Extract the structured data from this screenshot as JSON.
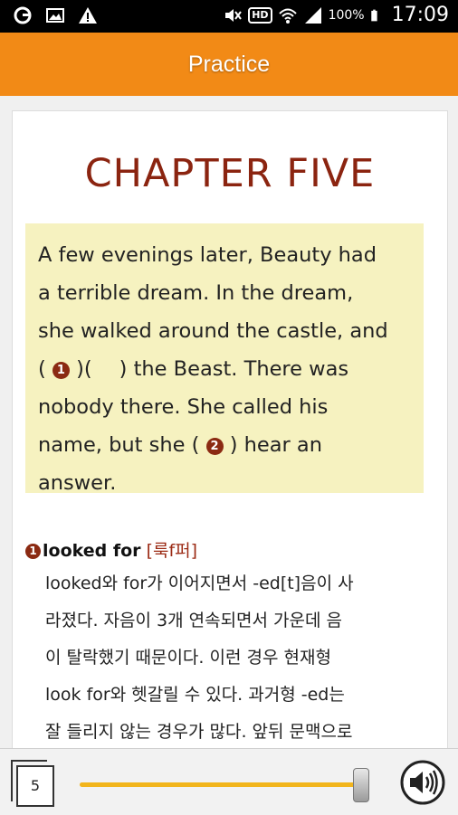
{
  "status_bar": {
    "battery_percent": "100%",
    "time": "17:09",
    "hd_label": "HD",
    "icons": [
      "g-app-icon",
      "image-icon",
      "warning-icon",
      "mute-icon",
      "hd-icon",
      "wifi-icon",
      "signal-icon",
      "battery-icon"
    ]
  },
  "header": {
    "title": "Practice"
  },
  "content": {
    "chapter_title": "CHAPTER FIVE",
    "passage": {
      "line1": "A few evenings later, Beauty had",
      "line2": "a terrible dream. In the dream,",
      "line3": "she walked around the castle, and",
      "line4_a": "( ",
      "line4_b": " )(",
      "line4_c": ") the Beast. There was",
      "line5": "nobody there. She called his",
      "line6_a": "name, but she ( ",
      "line6_b": " ) hear an",
      "line7": "answer.",
      "blank1_number": "1",
      "blank2_number": "2"
    },
    "note": {
      "number": "1",
      "term": "looked for",
      "pronunciation": "[룩f퍼]",
      "lines": [
        "looked와 for가 이어지면서 -ed[t]음이 사",
        "라졌다. 자음이 3개 연속되면서 가운데 음",
        "이 탈락했기 때문이다. 이런 경우 현재형",
        "look for와 헷갈릴 수 있다. 과거형 -ed는",
        "잘 들리지 않는 경우가 많다. 앞뒤 문맥으로"
      ]
    }
  },
  "bottom_bar": {
    "page_number": "5",
    "slider_fraction": 1.0,
    "accent_color": "#f2b51c"
  },
  "colors": {
    "header_bg": "#f28a16",
    "chapter_title": "#8b2410",
    "passage_bg": "#f6f2c0"
  }
}
